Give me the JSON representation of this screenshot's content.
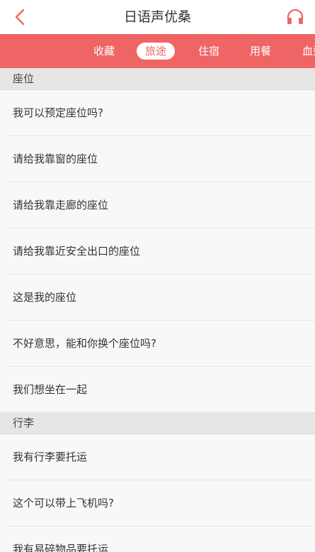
{
  "header": {
    "title": "日语声优桑"
  },
  "tabs": [
    {
      "label": "收藏"
    },
    {
      "label": "旅途"
    },
    {
      "label": "住宿"
    },
    {
      "label": "用餐"
    },
    {
      "label": "血型"
    }
  ],
  "active_tab": "旅途",
  "sections": [
    {
      "title": "座位",
      "items": [
        "我可以预定座位吗?",
        "请给我靠窗的座位",
        "请给我靠走廊的座位",
        "请给我靠近安全出口的座位",
        "这是我的座位",
        "不好意思，能和你换个座位吗?",
        "我们想坐在一起"
      ]
    },
    {
      "title": "行李",
      "items": [
        "我有行李要托运",
        "这个可以带上飞机吗?",
        "我有易碎物品要托运"
      ]
    }
  ],
  "colors": {
    "accent": "#ef6464",
    "section_bg": "#e6e6e6",
    "row_bg": "#f8f8f8",
    "text": "#333333"
  },
  "icons": {
    "back": "chevron-left-icon",
    "audio": "headphones-icon"
  }
}
